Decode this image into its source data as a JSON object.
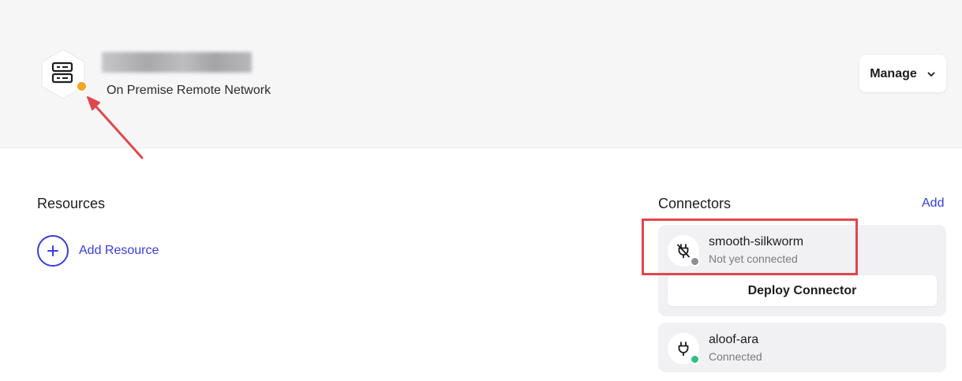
{
  "header": {
    "network_type": "On Premise Remote Network",
    "network_icon": "server-icon",
    "network_status_color": "#f5a623",
    "manage_label": "Manage"
  },
  "resources": {
    "title": "Resources",
    "add_label": "Add Resource"
  },
  "connectors": {
    "title": "Connectors",
    "add_label": "Add",
    "deploy_label": "Deploy Connector",
    "items": [
      {
        "name": "smooth-silkworm",
        "status": "Not yet connected",
        "status_color": "#8e8e93",
        "icon": "plug-off-icon"
      },
      {
        "name": "aloof-ara",
        "status": "Connected",
        "status_color": "#2ec27e",
        "icon": "plug-icon"
      }
    ]
  },
  "colors": {
    "accent": "#3a3de0",
    "annotation": "#e0474c"
  }
}
